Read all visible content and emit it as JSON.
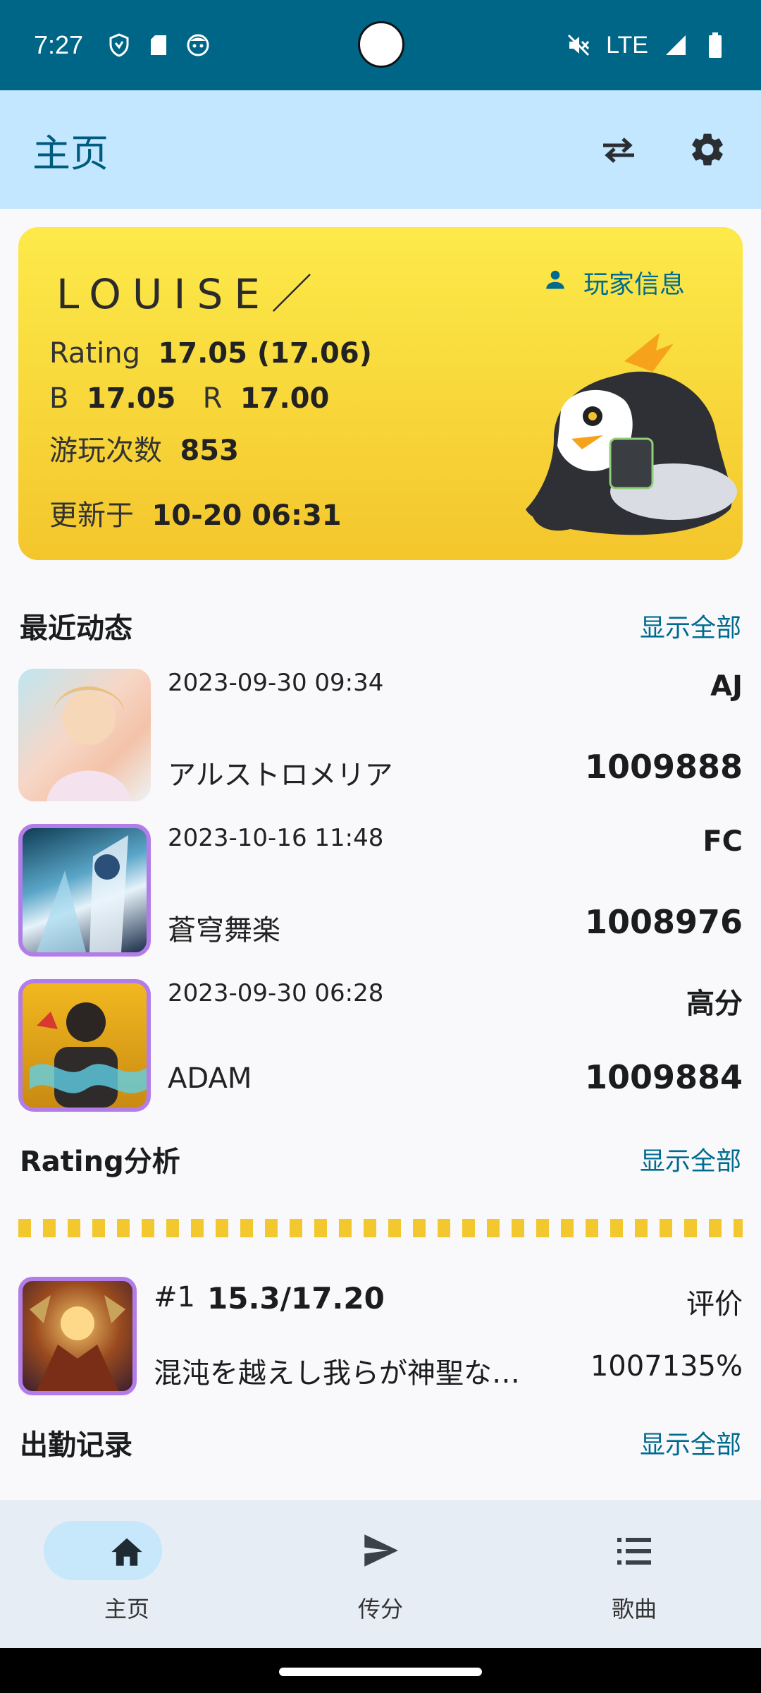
{
  "status_bar": {
    "time": "7:27",
    "network": "LTE"
  },
  "app_bar": {
    "title": "主页",
    "swap_icon": "swap-arrows-icon",
    "settings_icon": "gear-icon"
  },
  "player_card": {
    "name": "LOUISE／",
    "info_button": "玩家信息",
    "rating_label": "Rating",
    "rating_value": "17.05 (17.06)",
    "b_label": "B",
    "b_value": "17.05",
    "r_label": "R",
    "r_value": "17.00",
    "plays_label": "游玩次数",
    "plays_value": "853",
    "updated_label": "更新于",
    "updated_value": "10-20 06:31",
    "card_color_top": "#fdea4a",
    "card_color_bottom": "#f3c62c"
  },
  "recent": {
    "title": "最近动态",
    "show_all": "显示全部",
    "items": [
      {
        "date": "2023-09-30 09:34",
        "title": "アルストロメリア",
        "grade": "AJ",
        "score": "1009888"
      },
      {
        "date": "2023-10-16 11:48",
        "title": "蒼穹舞楽",
        "grade": "FC",
        "score": "1008976"
      },
      {
        "date": "2023-09-30 06:28",
        "title": "ADAM",
        "grade": "高分",
        "score": "1009884"
      }
    ]
  },
  "rating_analysis": {
    "title": "Rating分析",
    "show_all": "显示全部",
    "best": {
      "rank": "#1",
      "constant": "15.3/17.20",
      "eval_label": "评价",
      "title": "混沌を越えし我らが神聖な…",
      "score": "1007135%"
    }
  },
  "attendance": {
    "title": "出勤记录",
    "show_all": "显示全部"
  },
  "bottom_nav": {
    "items": [
      {
        "label": "主页",
        "icon": "home-icon",
        "active": true
      },
      {
        "label": "传分",
        "icon": "send-icon",
        "active": false
      },
      {
        "label": "歌曲",
        "icon": "list-icon",
        "active": false
      }
    ]
  },
  "colors": {
    "status_bar": "#006688",
    "app_bar": "#c2e7ff",
    "accent": "#006b8f",
    "thumb_border": "#b27de8"
  }
}
